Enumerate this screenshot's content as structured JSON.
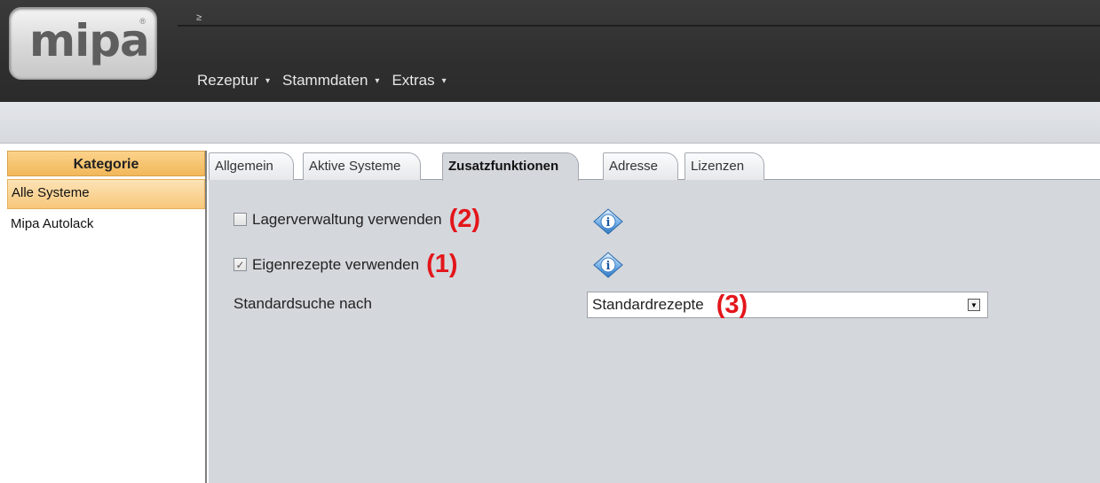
{
  "app": {
    "logo_text": "mipa",
    "quick_access_glyph": "≥"
  },
  "menu": {
    "items": [
      {
        "label": "Rezeptur"
      },
      {
        "label": "Stammdaten"
      },
      {
        "label": "Extras"
      }
    ],
    "arrow_glyph": "▾"
  },
  "sidebar": {
    "title": "Kategorie",
    "items": [
      {
        "label": "Alle Systeme",
        "active": true
      },
      {
        "label": "Mipa Autolack",
        "active": false
      }
    ]
  },
  "tabs": [
    {
      "label": "Allgemein"
    },
    {
      "label": "Aktive Systeme"
    },
    {
      "label": "Zusatzfunktionen",
      "active": true
    },
    {
      "label": "Adresse"
    },
    {
      "label": "Lizenzen"
    }
  ],
  "settings": {
    "lagerverwaltung": {
      "label": "Lagerverwaltung verwenden",
      "checked": false,
      "annotation": "(2)",
      "info_icon": "info-icon"
    },
    "eigenrezepte": {
      "label": "Eigenrezepte verwenden",
      "checked": true,
      "annotation": "(1)",
      "info_icon": "info-icon"
    },
    "standardsuche": {
      "label": "Standardsuche nach",
      "value": "Standardrezepte",
      "annotation": "(3)"
    }
  },
  "colors": {
    "annotation": "#e3161b",
    "sidebar_header": "#f2b75a",
    "content_bg": "#d4d7dc",
    "topbar": "#2f2f2f"
  }
}
